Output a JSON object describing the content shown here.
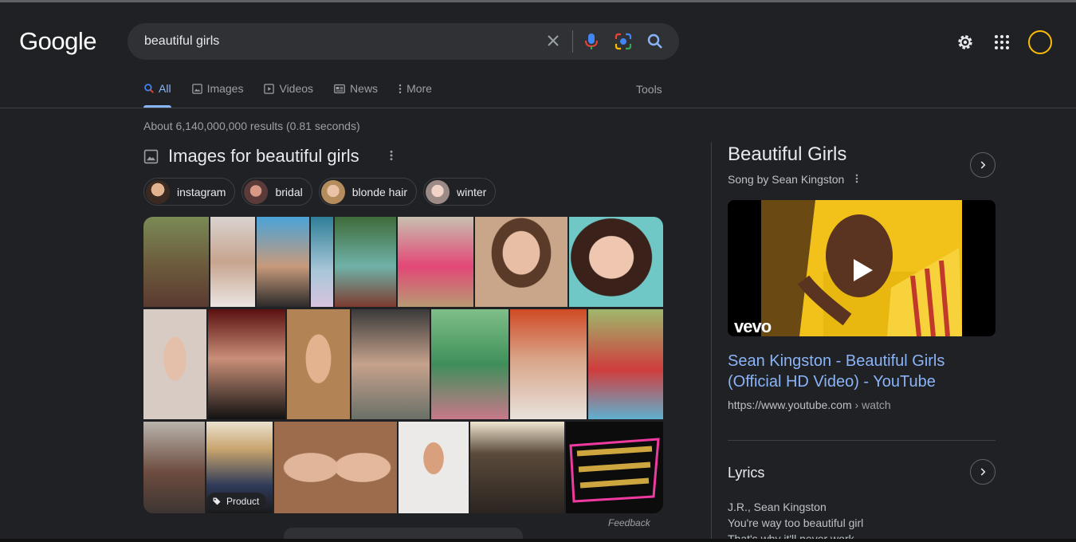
{
  "header": {
    "logo": "Google",
    "search_value": "beautiful girls"
  },
  "tabs": [
    {
      "label": "All",
      "icon": "search-icon",
      "active": true
    },
    {
      "label": "Images",
      "icon": "image-icon"
    },
    {
      "label": "Videos",
      "icon": "play-icon"
    },
    {
      "label": "News",
      "icon": "news-icon"
    },
    {
      "label": "More",
      "icon": "more-vert-icon"
    }
  ],
  "tools_label": "Tools",
  "results_stats": "About 6,140,000,000 results (0.81 seconds)",
  "images_section": {
    "title": "Images for beautiful girls",
    "chips": [
      "instagram",
      "bridal",
      "blonde hair",
      "winter"
    ],
    "product_badge": "Product",
    "feedback": "Feedback"
  },
  "knowledge_panel": {
    "title": "Beautiful Girls",
    "subtitle": "Song by Sean Kingston",
    "video_brand": "vevo",
    "video_title": "Sean Kingston - Beautiful Girls (Official HD Video) - YouTube",
    "video_domain": "https://www.youtube.com",
    "video_path": " › watch",
    "lyrics_heading": "Lyrics",
    "lyrics_lines": [
      "J.R., Sean Kingston",
      "You're way too beautiful girl",
      "That's why it'll never work"
    ]
  },
  "colors": {
    "background": "#202124",
    "link": "#8ab4f8",
    "avatar_ring": "#fbbc04"
  }
}
